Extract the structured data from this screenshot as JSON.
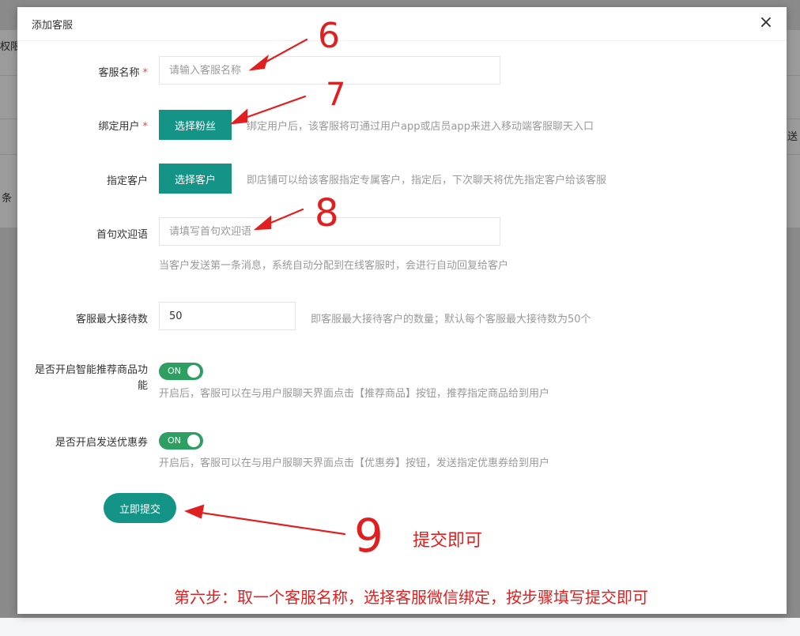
{
  "background": {
    "left_fragments": [
      "权限",
      "条"
    ],
    "right_fragment": "送"
  },
  "dialog": {
    "title": "添加客服",
    "close_symbol": "×"
  },
  "form": {
    "name": {
      "label": "客服名称",
      "required_mark": "*",
      "placeholder": "请输入客服名称"
    },
    "bind_user": {
      "label": "绑定用户",
      "required_mark": "*",
      "button": "选择粉丝",
      "hint": "绑定用户后，该客服将可通过用户app或店员app来进入移动端客服聊天入口"
    },
    "assign_customer": {
      "label": "指定客户",
      "button": "选择客户",
      "hint": "即店铺可以给该客服指定专属客户，指定后，下次聊天将优先指定客户给该客服"
    },
    "welcome": {
      "label": "首句欢迎语",
      "placeholder": "请填写首句欢迎语",
      "hint": "当客户发送第一条消息，系统自动分配到在线客服时，会进行自动回复给客户"
    },
    "max_reception": {
      "label": "客服最大接待数",
      "value": "50",
      "hint": "即客服最大接待客户的数量；默认每个客服最大接待数为50个"
    },
    "recommend_goods": {
      "label": "是否开启智能推荐商品功能",
      "switch_text": "ON",
      "on": true,
      "hint": "开启后，客服可以在与用户服聊天界面点击【推荐商品】按钮，推荐指定商品给到用户"
    },
    "send_coupon": {
      "label": "是否开启发送优惠券",
      "switch_text": "ON",
      "on": true,
      "hint": "开启后，客服可以在与用户服聊天界面点击【优惠券】按钮，发送指定优惠券给到用户"
    },
    "submit": "立即提交"
  },
  "annotations": {
    "color": "#e02020",
    "numbers": [
      "6",
      "7",
      "8",
      "9"
    ],
    "submit_note": "提交即可",
    "step_note": "第六步：取一个客服名称，选择客服微信绑定，按步骤填写提交即可"
  }
}
